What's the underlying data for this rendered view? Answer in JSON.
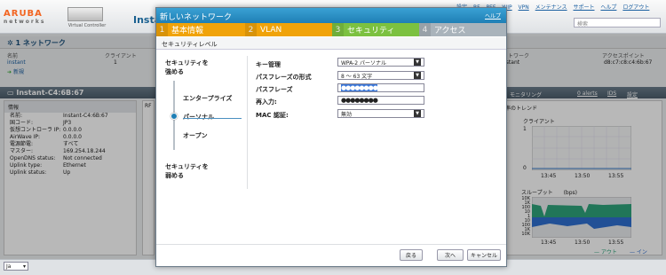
{
  "header": {
    "brand_name": "ARUBA",
    "brand_sub": "networks",
    "vc_caption": "Virtual Controller",
    "app_title": "Insta",
    "links": [
      "設定",
      "RF",
      "PEF",
      "WIP",
      "VPN",
      "メンテナンス",
      "サポート",
      "ヘルプ",
      "ログアウト"
    ],
    "search_placeholder": "検索"
  },
  "networks": {
    "title": "1 ネットワーク",
    "col_name": "名前",
    "col_clients": "クライアント",
    "col_ap_partial": "ットワーク",
    "col_ap": "アクセスポイント",
    "row_name": "instant",
    "row_clients": "1",
    "row_net": "nstant",
    "row_ap": "d8:c7:c8:c4:6b:67",
    "new_link": "新規"
  },
  "device": {
    "title": "Instant-C4:6B:67",
    "info_header": "情報",
    "rows": [
      {
        "k": "名前:",
        "v": "Instant-C4:6B:67"
      },
      {
        "k": "国コード:",
        "v": "JP3"
      },
      {
        "k": "仮想コントローラ IP:",
        "v": "0.0.0.0"
      },
      {
        "k": "AirWave IP:",
        "v": "0.0.0.0"
      },
      {
        "k": "電源節電:",
        "v": "すべて"
      },
      {
        "k": "マスター:",
        "v": "169.254.18.244"
      },
      {
        "k": "OpenDNS status:",
        "v": "Not connected"
      },
      {
        "k": "Uplink type:",
        "v": "Ethernet"
      },
      {
        "k": "Uplink status:",
        "v": "Up"
      }
    ],
    "rf_label": "RF"
  },
  "monitoring": {
    "label": "モニタリング",
    "alerts": "0 alerts",
    "ids": "IDS",
    "settings": "設定",
    "trend_title": "用率のトレンド",
    "clients_title": "クライアント",
    "throughput_title": "スループット",
    "throughput_unit": "(bps)",
    "time_labels": [
      "13:45",
      "13:50",
      "13:55"
    ],
    "client_ticks": [
      "1",
      "0"
    ],
    "tp_ticks": [
      "10K",
      "1K",
      "100",
      "10",
      "1",
      "10",
      "100",
      "1K",
      "10K"
    ],
    "legend_out": "アウト",
    "legend_in": "イン"
  },
  "footer": {
    "lang": "Ja"
  },
  "dialog": {
    "title": "新しいネットワーク",
    "help": "ヘルプ",
    "steps": [
      {
        "num": "1",
        "label": "基本情報",
        "color": "#f0a30a"
      },
      {
        "num": "2",
        "label": "VLAN",
        "color": "#f0a30a"
      },
      {
        "num": "3",
        "label": "セキュリティ",
        "color": "#7cc140"
      },
      {
        "num": "4",
        "label": "アクセス",
        "color": "#a9b3bb"
      }
    ],
    "section_title": "セキュリティレベル",
    "slider": {
      "top_label": "セキュリティを\n強める",
      "opt_enterprise": "エンタープライズ",
      "opt_personal": "パーソナル",
      "opt_open": "オープン",
      "bottom_label": "セキュリティを\n弱める"
    },
    "fields": {
      "key_mgmt_label": "キー管理",
      "key_mgmt_value": "WPA-2 パーソナル",
      "pp_format_label": "パスフレーズの形式",
      "pp_format_value": "8 ～ 63 文字",
      "passphrase_label": "パスフレーズ",
      "passphrase_value": "●●●●●●●●",
      "reenter_label": "再入力:",
      "reenter_value": "●●●●●●●●",
      "mac_auth_label": "MAC 認証:",
      "mac_auth_value": "無効"
    },
    "buttons": {
      "back": "戻る",
      "next": "次へ",
      "cancel": "キャンセル"
    }
  }
}
